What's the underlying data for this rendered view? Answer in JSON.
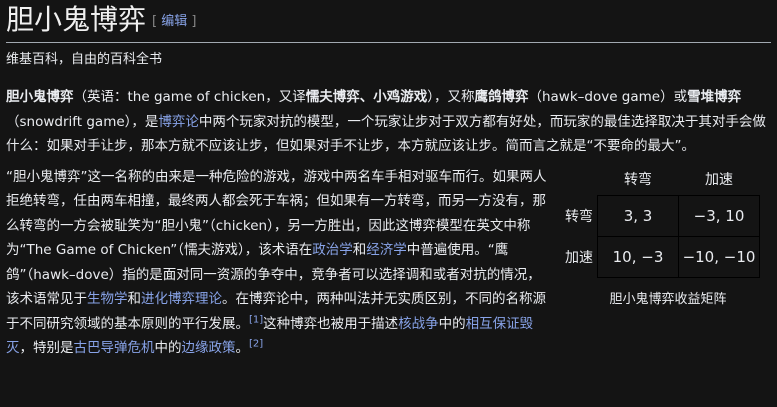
{
  "title": "胆小鬼博弈",
  "edit": {
    "open": "[",
    "label": "编辑",
    "close": "]"
  },
  "tagline": "维基百科，自由的百科全书",
  "p1": {
    "t1": "胆小鬼博弈",
    "t2": "（英语：the game of chicken，又译",
    "t3": "懦夫博弈",
    "t4": "、",
    "t5": "小鸡游戏",
    "t6": "），又称",
    "t7": "鹰鸽博弈",
    "t8": "（hawk–dove game）或",
    "t9": "雪堆博弈",
    "t10": "（snowdrift game），是",
    "link1": "博弈论",
    "t11": "中两个玩家对抗的模型，一个玩家让步对于双方都有好处，而玩家的最佳选择取决于其对手会做什么：如果对手让步，那本方就不应该让步，但如果对手不让步，本方就应该让步。简而言之就是“不要命的最大”。"
  },
  "p2": {
    "t1": "“胆小鬼博弈”这一名称的由来是一种危险的游戏，游戏中两名车手相对驱车而行。如果两人拒绝转弯，任由两车相撞，最终两人都会死于车祸；但如果有一方转弯，而另一方没有，那么转弯的一方会被耻笑为“胆小鬼”（chicken），另一方胜出，因此这博弈模型在英文中称为“The Game of Chicken”（懦夫游戏），该术语在",
    "link1": "政治学",
    "t2": "和",
    "link2": "经济学",
    "t3": "中普遍使用。“鹰鸽”（hawk–dove）指的是面对同一资源的争夺中，竞争者可以选择调和或者对抗的情况，该术语常见于",
    "link3": "生物学",
    "t4": "和",
    "link4": "进化博弈理论",
    "t5": "。在博弈论中，两种叫法并无实质区别，不同的名称源于不同研究领域的基本原则的平行发展。",
    "ref1": "[1]",
    "t6": "这种博弈也被用于描述",
    "link5": "核战争",
    "t7": "中的",
    "link6": "相互保证毁灭",
    "t8": "，特别是",
    "link7": "古巴导弹危机",
    "t9": "中的",
    "link8": "边缘政策",
    "t10": "。",
    "ref2": "[2]"
  },
  "matrix": {
    "cols": [
      "转弯",
      "加速"
    ],
    "rows": [
      {
        "label": "转弯",
        "cells": [
          "3, 3",
          "−3, 10"
        ]
      },
      {
        "label": "加速",
        "cells": [
          "10, −3",
          "−10, −10"
        ]
      }
    ],
    "caption": "胆小鬼博弈收益矩阵"
  }
}
